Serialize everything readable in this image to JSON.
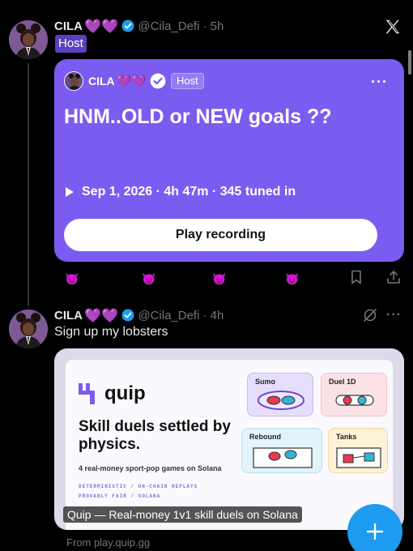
{
  "tweet1": {
    "author_name": "CILA",
    "hearts": "💜💜",
    "handle": "@Cila_Defi",
    "time": "· 5h",
    "role_badge": "Host"
  },
  "space_card": {
    "host_name": "CILA",
    "hearts": "💜💜",
    "host_badge": "Host",
    "more": "···",
    "title": "HNM..OLD or NEW goals ??",
    "meta": "Sep 1, 2026 · 4h 47m · 345 tuned in",
    "button_label": "Play recording",
    "accent_color": "#7b5cf0"
  },
  "reactions": [
    "😈",
    "😈",
    "😈",
    "😈"
  ],
  "tweet2": {
    "author_name": "CILA",
    "hearts": "💜💜",
    "handle": "@Cila_Defi",
    "time": "· 4h",
    "more": "···",
    "text": "Sign up my lobsters"
  },
  "link_card": {
    "brand": "quip",
    "headline": "Skill duels settled by physics.",
    "subheadline": "4 real-money sport-pop games on Solana",
    "tag_line_1": "DETERMINISTIC / ON-CHAIN REPLAYS",
    "tag_line_2": "PROVABLY FAIR / SOLANA",
    "games": [
      "Sumo",
      "Duel 1D",
      "Rebound",
      "Tanks"
    ],
    "caption": "Quip — Real-money 1v1 skill duels on Solana",
    "domain": "From play.quip.gg"
  },
  "colors": {
    "accent_blue": "#1d9bf0",
    "purple": "#9b5cf6",
    "muted": "#71767b"
  }
}
